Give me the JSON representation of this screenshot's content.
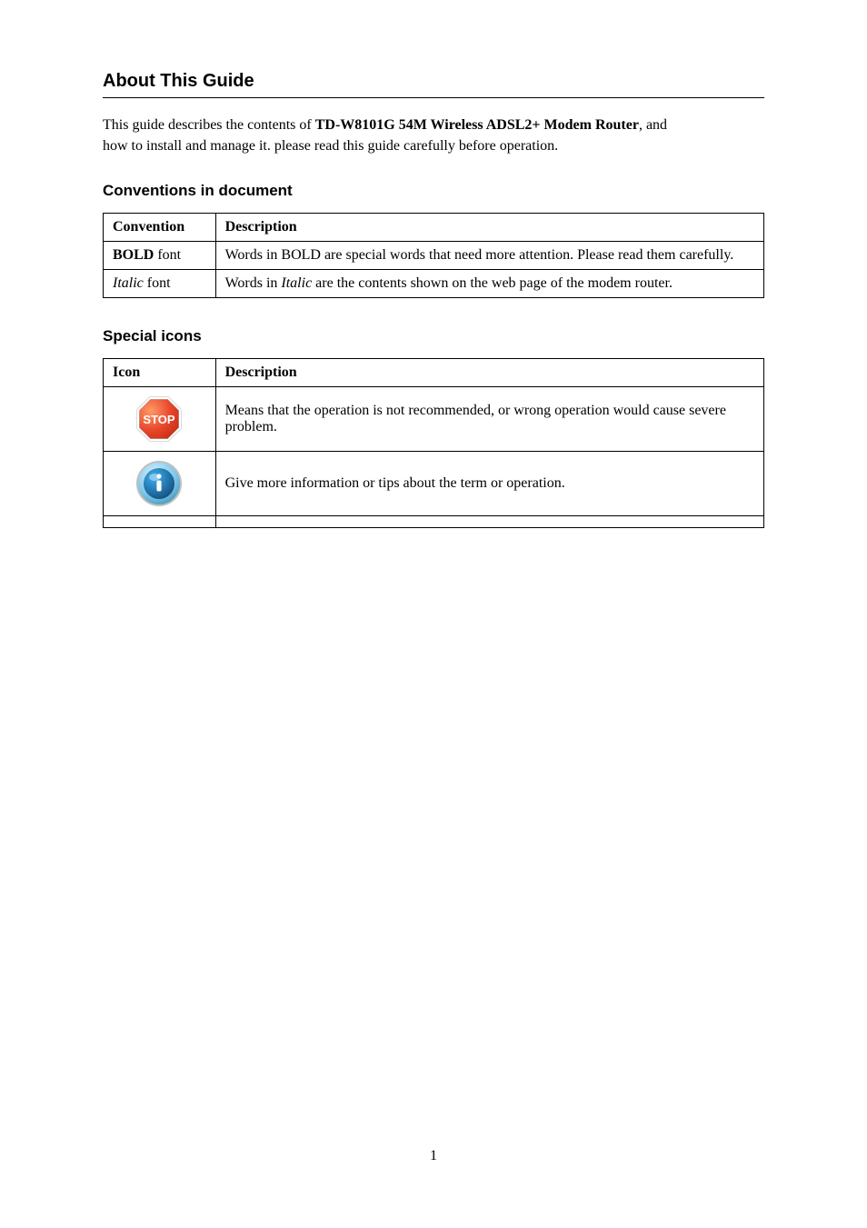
{
  "title": "About This Guide",
  "intro": {
    "line1_a": "This guide describes the contents of ",
    "line1_b": "TD-W8101G 54M Wireless ADSL2+ Modem Router",
    "line1_c": ", and",
    "line2": "how to install and manage it. please read this guide carefully before operation."
  },
  "table1": {
    "heading": "Conventions in document",
    "header_left": "Convention",
    "header_right": "Description",
    "rows": [
      {
        "left_a": "BOLD",
        "left_b": " font",
        "right": "Words in BOLD are special words that need more attention. Please read them carefully."
      },
      {
        "left_a": "Italic",
        "left_b": " font",
        "right_a": "Words in ",
        "right_b": "Italic",
        "right_c": " are the contents shown on the web page of the modem router."
      }
    ]
  },
  "table2": {
    "heading": "Special icons",
    "header_left": "Icon",
    "header_right": "Description",
    "rows": [
      {
        "icon": "stop",
        "right": "Means that the operation is not recommended, or wrong operation would cause severe problem."
      },
      {
        "icon": "info",
        "right": "Give more information or tips about the term or operation."
      },
      {
        "icon": "none",
        "right": ""
      }
    ]
  },
  "page_number": "1"
}
